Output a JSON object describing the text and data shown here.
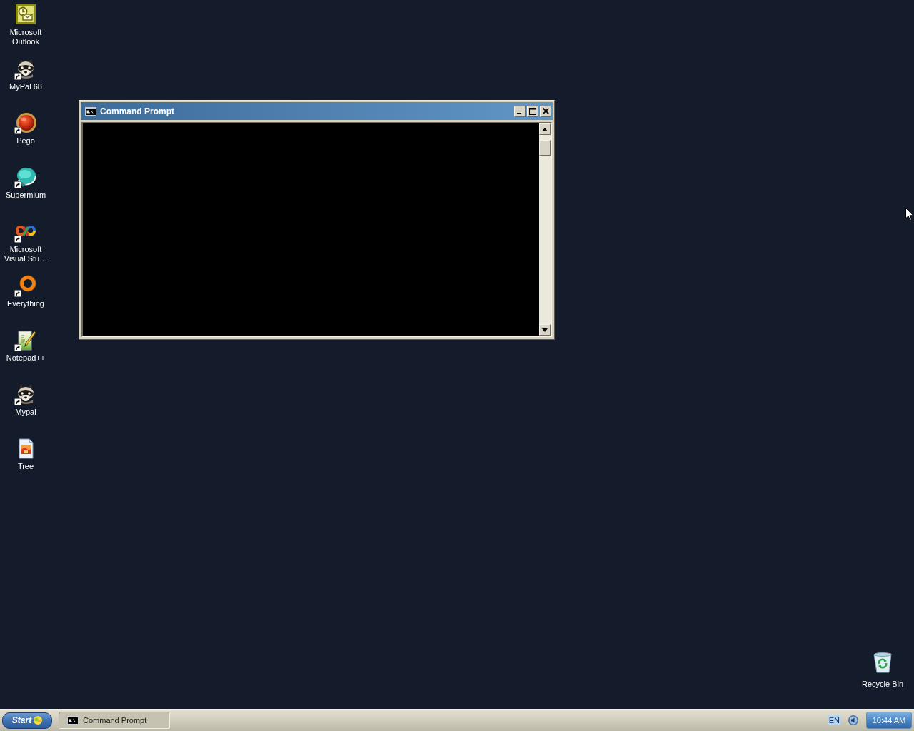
{
  "desktop_icons": [
    {
      "label": "Microsoft Outlook",
      "kind": "mail",
      "shortcut": false
    },
    {
      "label": "MyPal 68",
      "kind": "raccoon",
      "shortcut": true
    },
    {
      "label": "Pego",
      "kind": "orb",
      "shortcut": true
    },
    {
      "label": "Supermium",
      "kind": "globe",
      "shortcut": true
    },
    {
      "label": "Microsoft Visual Stu…",
      "kind": "infinity",
      "shortcut": true
    },
    {
      "label": "Everything",
      "kind": "ring",
      "shortcut": true
    },
    {
      "label": "Notepad++",
      "kind": "notepad",
      "shortcut": true
    },
    {
      "label": "Mypal",
      "kind": "raccoon",
      "shortcut": true
    },
    {
      "label": "Tree",
      "kind": "file",
      "shortcut": false
    }
  ],
  "recycle_bin": {
    "label": "Recycle Bin"
  },
  "window": {
    "title": "Command Prompt",
    "active": true
  },
  "taskbar": {
    "start": {
      "label": "Start"
    },
    "tasks": [
      {
        "label": "Command Prompt",
        "selected": true
      }
    ],
    "tray": {
      "language": "EN",
      "clock": "10:44 AM"
    }
  }
}
